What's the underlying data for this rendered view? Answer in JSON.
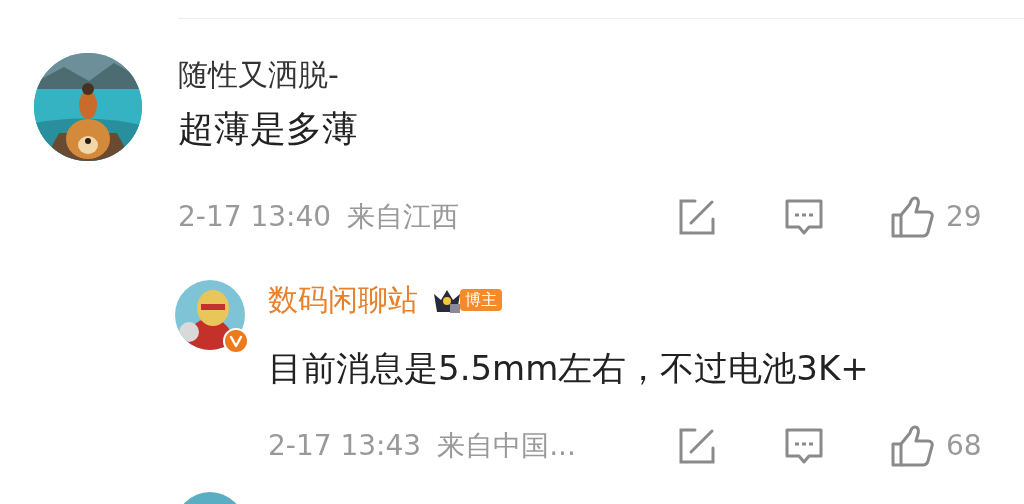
{
  "comments": [
    {
      "author": "随性又洒脱-",
      "highlighted": false,
      "verified": false,
      "text": "超薄是多薄",
      "time": "2-17 13:40",
      "location": "来自江西",
      "likes": "29",
      "replies": [
        {
          "author": "数码闲聊站",
          "highlighted": true,
          "verified": true,
          "badge": "博主",
          "text": "目前消息是5.5mm左右，不过电池3K+",
          "time": "2-17 13:43",
          "location": "来自中国...",
          "likes": "68"
        }
      ]
    }
  ]
}
